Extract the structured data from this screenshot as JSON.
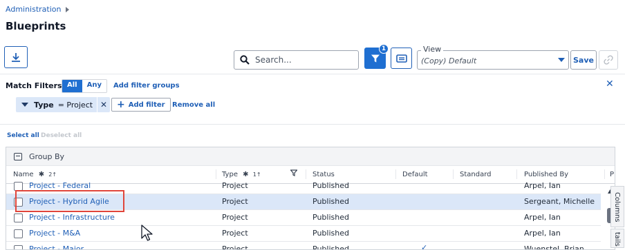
{
  "breadcrumb": {
    "label": "Administration"
  },
  "page": {
    "title": "Blueprints"
  },
  "toolbar": {
    "search_placeholder": "Search...",
    "filter_count": "1",
    "view_label": "View",
    "view_value": "(Copy) Default",
    "save_label": "Save"
  },
  "filters": {
    "match_label": "Match Filters",
    "all_label": "All",
    "any_label": "Any",
    "add_groups_label": "Add filter groups",
    "chip_key": "Type",
    "chip_value": "= Project",
    "add_filter_label": "Add filter",
    "remove_all_label": "Remove all"
  },
  "selection": {
    "select_all": "Select all",
    "deselect_all": "Deselect all"
  },
  "grid": {
    "group_by_label": "Group By",
    "columns": {
      "name": "Name",
      "name_sort": "2↑",
      "type": "Type",
      "type_sort": "1↑",
      "status": "Status",
      "default": "Default",
      "standard": "Standard",
      "published_by": "Published By",
      "next": "P"
    },
    "rows": [
      {
        "name": "Project - Federal",
        "type": "Project",
        "status": "Published",
        "published_by": "Arpel, Ian"
      },
      {
        "name": "Project - Hybrid Agile",
        "type": "Project",
        "status": "Published",
        "published_by": "Sergeant, Michelle"
      },
      {
        "name": "Project - Infrastructure",
        "type": "Project",
        "status": "Published",
        "published_by": "Arpel, Ian"
      },
      {
        "name": "Project - M&A",
        "type": "Project",
        "status": "Published",
        "published_by": "Arpel, Ian"
      },
      {
        "name": "Project - Major",
        "type": "Project",
        "status": "Published",
        "published_by": "Wuenstel, Brian"
      }
    ]
  },
  "side_tabs": {
    "columns": "Columns",
    "details": "tails"
  },
  "colors": {
    "accent": "#1f6fd1",
    "link": "#1f5fb6",
    "selected_row": "#dbe7f8",
    "highlight": "#e0453a"
  }
}
